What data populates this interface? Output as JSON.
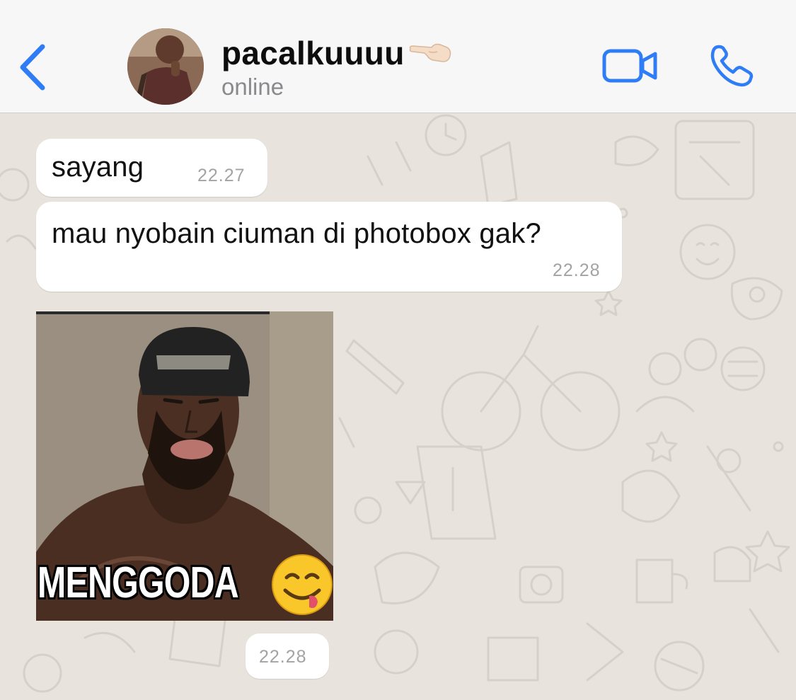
{
  "header": {
    "back_icon": "chevron-left-icon",
    "contact_name": "pacalkuuuu",
    "contact_emoji": "pointing-left-hand-emoji",
    "status": "online",
    "video_icon": "video-camera-icon",
    "call_icon": "phone-icon",
    "accent_color": "#2f7df6"
  },
  "messages": [
    {
      "text": "sayang",
      "time": "22.27"
    },
    {
      "text": "mau nyobain ciuman di photobox gak?",
      "time": "22.28"
    }
  ],
  "sticker": {
    "caption": "MENGGODA",
    "emoji": "face-savoring-food-emoji",
    "time": "22.28"
  },
  "colors": {
    "header_bg": "#f7f7f7",
    "chat_bg": "#e8e4dd",
    "bubble_bg": "#ffffff",
    "timestamp": "#a3a3a3"
  }
}
